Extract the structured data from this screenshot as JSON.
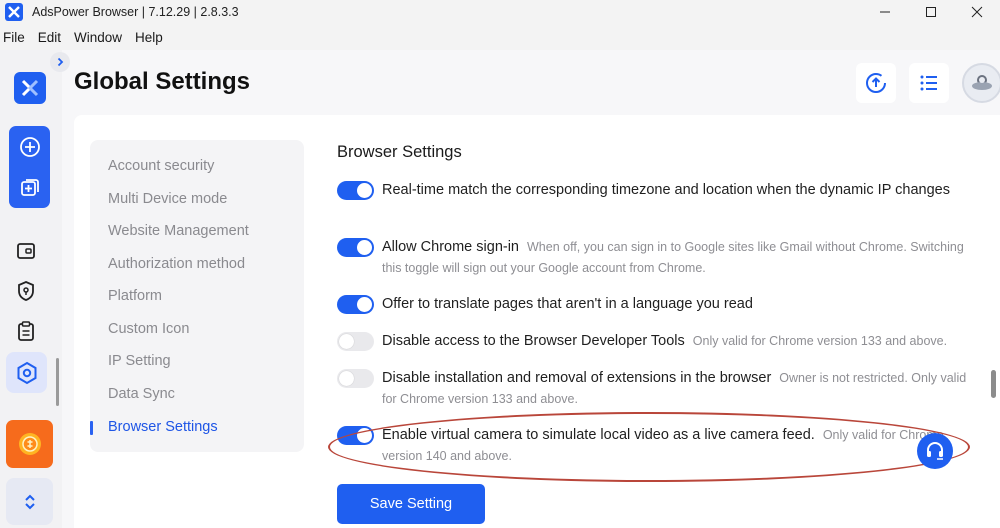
{
  "window": {
    "title": "AdsPower Browser | 7.12.29 | 2.8.3.3"
  },
  "menu": {
    "items": [
      "File",
      "Edit",
      "Window",
      "Help"
    ]
  },
  "header": {
    "title": "Global Settings"
  },
  "rail": {
    "icons": [
      "adspower-logo-icon",
      "chevron-right-icon",
      "plus-circle-icon",
      "batch-add-icon",
      "wallet-icon",
      "shield-icon",
      "clipboard-icon",
      "settings-hexagon-icon",
      "app-coin-icon",
      "chevron-updown-icon"
    ]
  },
  "subnav": {
    "items": [
      {
        "label": "Account security",
        "active": false
      },
      {
        "label": "Multi Device mode",
        "active": false
      },
      {
        "label": "Website Management",
        "active": false
      },
      {
        "label": "Authorization method",
        "active": false
      },
      {
        "label": "Platform",
        "active": false
      },
      {
        "label": "Custom Icon",
        "active": false
      },
      {
        "label": "IP Setting",
        "active": false
      },
      {
        "label": "Data Sync",
        "active": false
      },
      {
        "label": "Browser Settings",
        "active": true
      }
    ]
  },
  "section": {
    "title": "Browser Settings",
    "settings": [
      {
        "label": "Real-time match the corresponding timezone and location when the dynamic IP changes",
        "hint": "",
        "enabled": true
      },
      {
        "label": "Allow Chrome sign-in",
        "hint": "When off, you can sign in to Google sites like Gmail without Chrome. Switching this toggle will sign out your Google account from Chrome.",
        "enabled": true
      },
      {
        "label": "Offer to translate pages that aren't in a language you read",
        "hint": "",
        "enabled": true
      },
      {
        "label": "Disable access to the Browser Developer Tools",
        "hint": "Only valid for Chrome version 133 and above.",
        "enabled": false
      },
      {
        "label": "Disable installation and removal of extensions in the browser",
        "hint": "Owner is not restricted. Only valid for Chrome version 133 and above.",
        "enabled": false
      },
      {
        "label": "Enable virtual camera to simulate local video as a live camera feed.",
        "hint": "Only valid for Chrome version 140 and above.",
        "enabled": true
      }
    ]
  },
  "actions": {
    "save_label": "Save Setting"
  },
  "colors": {
    "accent": "#1f5ff0",
    "highlight_ring": "#b9463a"
  }
}
